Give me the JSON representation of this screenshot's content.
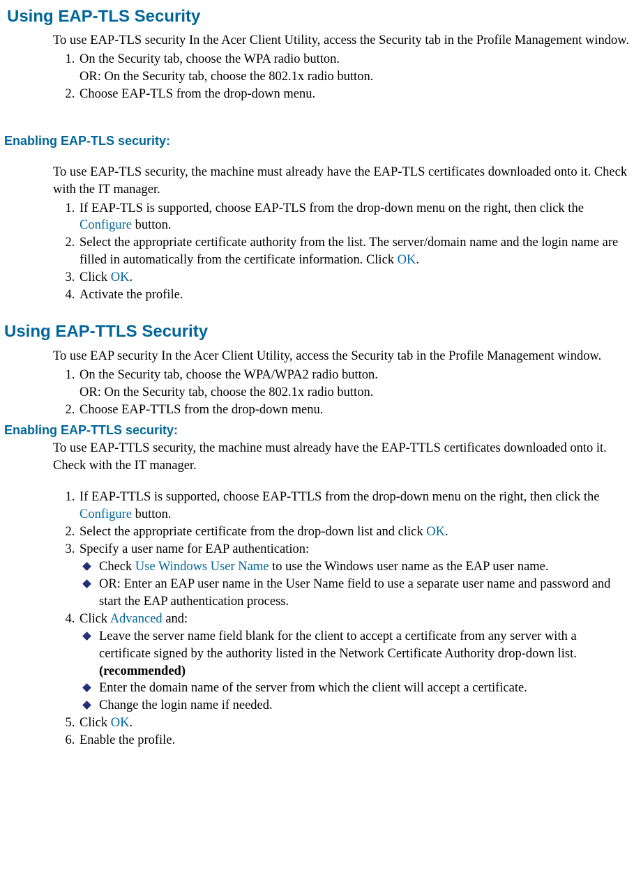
{
  "sec1": {
    "title": "Using EAP-TLS Security",
    "intro": "To use EAP-TLS security In the Acer Client Utility, access the Security tab in the Profile Management window.",
    "steps": {
      "s1a": "On the Security tab, choose the WPA radio button.",
      "s1b": "OR: On the Security tab, choose the 802.1x radio button.",
      "s2": "Choose EAP-TLS from the drop-down menu."
    },
    "sub_title": "Enabling EAP-TLS security:",
    "sub_intro": "To use EAP-TLS security, the machine must already have the EAP-TLS certificates downloaded onto it. Check with the IT manager.",
    "sub_steps": {
      "s1_pre": "If EAP-TLS is supported, choose EAP-TLS from the drop-down menu on the right, then click the ",
      "s1_link": "Configure",
      "s1_post": " button.",
      "s2_pre": "Select the appropriate certificate authority from the list. The server/domain name and the login name are filled in automatically from the certificate information. Click ",
      "s2_link": "OK",
      "s2_post": ".",
      "s3_pre": "Click ",
      "s3_link": "OK",
      "s3_post": ".",
      "s4": "Activate the profile."
    }
  },
  "sec2": {
    "title": "Using EAP-TTLS Security",
    "intro": "To use EAP security In the Acer Client Utility, access the Security tab in the Profile Management window.",
    "steps": {
      "s1a": "On the Security tab, choose the WPA/WPA2 radio button.",
      "s1b": "OR: On the Security tab, choose the 802.1x radio button.",
      "s2": "Choose EAP-TTLS from the drop-down menu."
    },
    "sub_title": "Enabling EAP-TTLS security:",
    "sub_intro": "To use EAP-TTLS security, the machine must already have the EAP-TTLS certificates downloaded onto it. Check with the IT manager.",
    "sub_steps": {
      "s1_pre": "If EAP-TTLS is supported, choose EAP-TTLS from the drop-down menu on the right, then click the ",
      "s1_link": "Configure",
      "s1_post": " button.",
      "s2_pre": "Select the appropriate certificate from the drop-down list and click ",
      "s2_link": "OK",
      "s2_post": ".",
      "s3": "Specify a user name for EAP authentication:",
      "s3_b1_pre": "Check ",
      "s3_b1_link": "Use Windows User Name",
      "s3_b1_post": " to use the Windows user name as the EAP user name.",
      "s3_b2": "OR: Enter an EAP user name in the User Name field to use a separate user name and password and start the EAP authentication process.",
      "s4_pre": "Click ",
      "s4_link": "Advanced",
      "s4_post": " and:",
      "s4_b1_pre": "Leave the server name field blank for the client to accept a certificate from any server with a certificate signed by the authority listed in the Network Certificate Authority drop-down list. ",
      "s4_b1_bold": "(recommended)",
      "s4_b2": "Enter the domain name of the server from which the client will accept a certificate.",
      "s4_b3": "Change the login name if needed.",
      "s5_pre": "Click ",
      "s5_link": "OK",
      "s5_post": ".",
      "s6": "Enable the profile."
    }
  }
}
